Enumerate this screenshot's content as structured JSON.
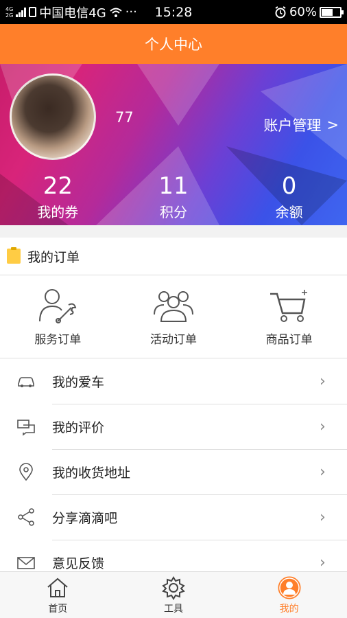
{
  "status_bar": {
    "network_small_top": "4G",
    "network_small_bottom": "2G",
    "carrier": "中国电信4G",
    "more": "···",
    "time": "15:28",
    "battery_percent": "60%",
    "battery_level": 0.6
  },
  "header": {
    "title": "个人中心"
  },
  "profile": {
    "username": "77",
    "account_link": "账户管理",
    "account_chevron": ">",
    "stats": [
      {
        "value": "22",
        "label": "我的券"
      },
      {
        "value": "11",
        "label": "积分"
      },
      {
        "value": "0",
        "label": "余额"
      }
    ]
  },
  "orders_section": {
    "title": "我的订单",
    "items": [
      {
        "label": "服务订单",
        "icon": "service-order-icon"
      },
      {
        "label": "活动订单",
        "icon": "activity-order-icon"
      },
      {
        "label": "商品订单",
        "icon": "cart-icon"
      }
    ]
  },
  "menu": [
    {
      "label": "我的爱车",
      "icon": "car-icon"
    },
    {
      "label": "我的评价",
      "icon": "comment-icon"
    },
    {
      "label": "我的收货地址",
      "icon": "location-icon"
    },
    {
      "label": "分享滴滴吧",
      "icon": "share-icon"
    },
    {
      "label": "意见反馈",
      "icon": "mail-icon"
    }
  ],
  "tabbar": [
    {
      "label": "首页",
      "icon": "home-icon"
    },
    {
      "label": "工具",
      "icon": "gear-icon"
    },
    {
      "label": "我的",
      "icon": "user-icon",
      "active": true
    }
  ],
  "colors": {
    "accent": "#ff7f2a",
    "text": "#222222",
    "divider": "#dddddd"
  }
}
